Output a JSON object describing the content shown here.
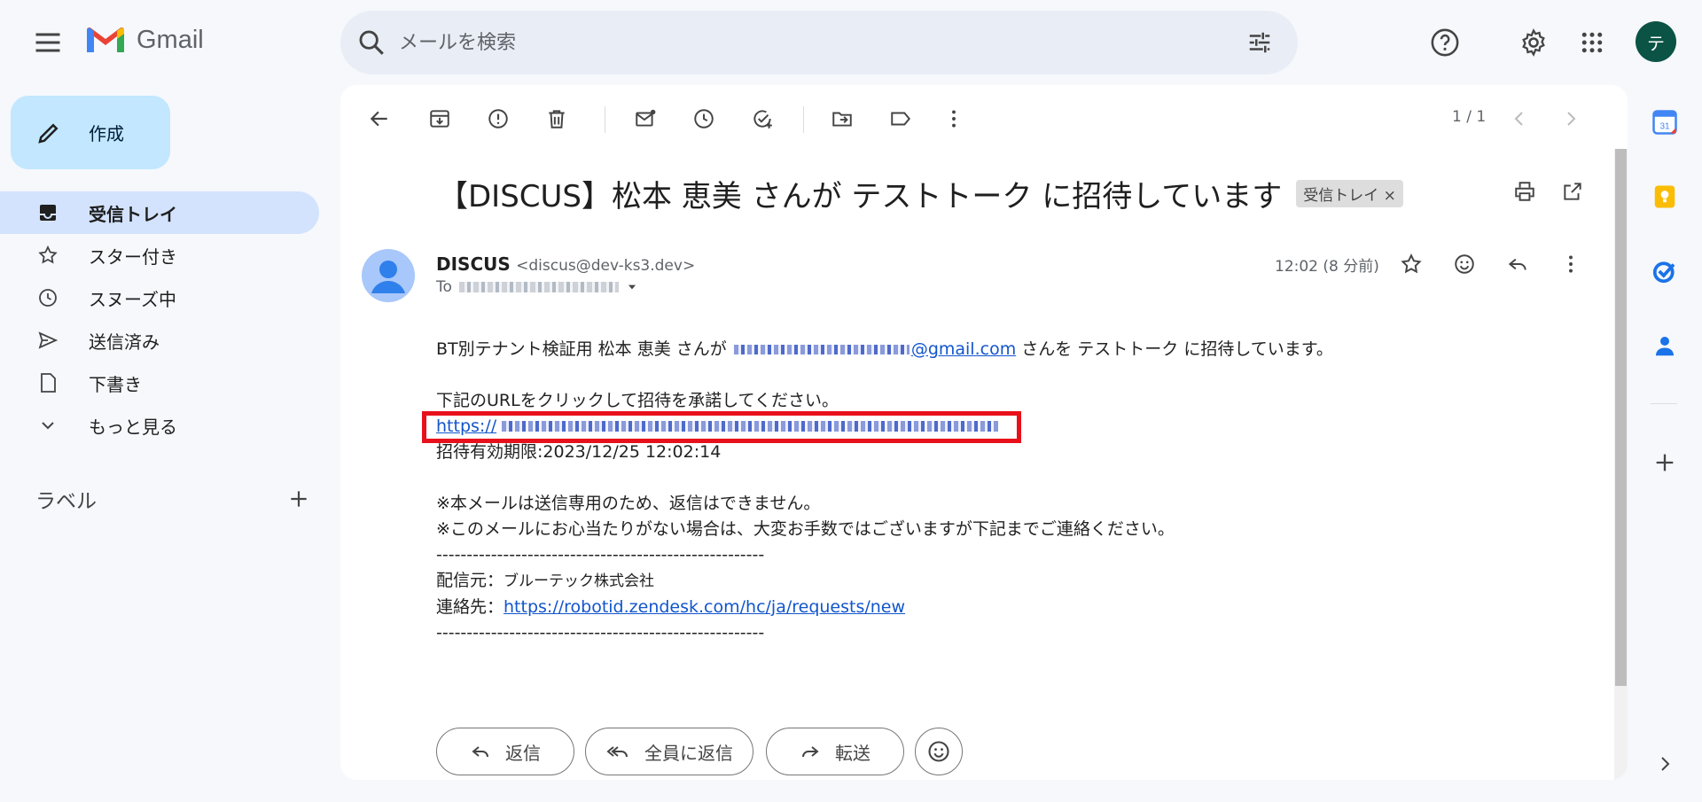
{
  "app": {
    "name": "Gmail"
  },
  "search": {
    "placeholder": "メールを検索"
  },
  "account": {
    "avatar_letter": "テ",
    "avatar_color": "#0b5345"
  },
  "compose": {
    "label": "作成"
  },
  "nav": {
    "items": [
      {
        "label": "受信トレイ",
        "icon": "inbox-icon",
        "active": true
      },
      {
        "label": "スター付き",
        "icon": "star-icon"
      },
      {
        "label": "スヌーズ中",
        "icon": "clock-icon"
      },
      {
        "label": "送信済み",
        "icon": "send-icon"
      },
      {
        "label": "下書き",
        "icon": "draft-icon"
      },
      {
        "label": "もっと見る",
        "icon": "chevron-down-icon"
      }
    ],
    "labels_heading": "ラベル"
  },
  "toolbar": {
    "pager": "1 / 1"
  },
  "email": {
    "subject": "【DISCUS】松本 恵美 さんが テストトーク に招待しています",
    "inbox_chip": "受信トレイ",
    "sender_name": "DISCUS",
    "sender_address": "<discus@dev-ks3.dev>",
    "to_prefix": "To",
    "time": "12:02 (8 分前)",
    "line1_pre": "BT別テナント検証用 松本 恵美 さんが",
    "line1_email_domain": "@gmail.com",
    "line1_post": "さんを テストトーク に招待しています。",
    "line2": "下記のURLをクリックして招待を承諾してください。",
    "invite_link_prefix": "https://",
    "expiry": "招待有効期限:2023/12/25 12:02:14",
    "notice1": "※本メールは送信専用のため、返信はできません。",
    "notice2": "※このメールにお心当たりがない場合は、大変お手数ではございますが下記までご連絡ください。",
    "divider": "------------------------------------------------------",
    "sender_company_label": "配信元：",
    "sender_company": "ブルーテック株式会社",
    "contact_label": "連絡先：",
    "contact_url": "https://robotid.zendesk.com/hc/ja/requests/new"
  },
  "actions": {
    "reply": "返信",
    "reply_all": "全員に返信",
    "forward": "転送"
  },
  "colors": {
    "highlight_border": "#e8101b",
    "compose_bg": "#c2e7ff",
    "active_nav_bg": "#d3e3fd"
  }
}
